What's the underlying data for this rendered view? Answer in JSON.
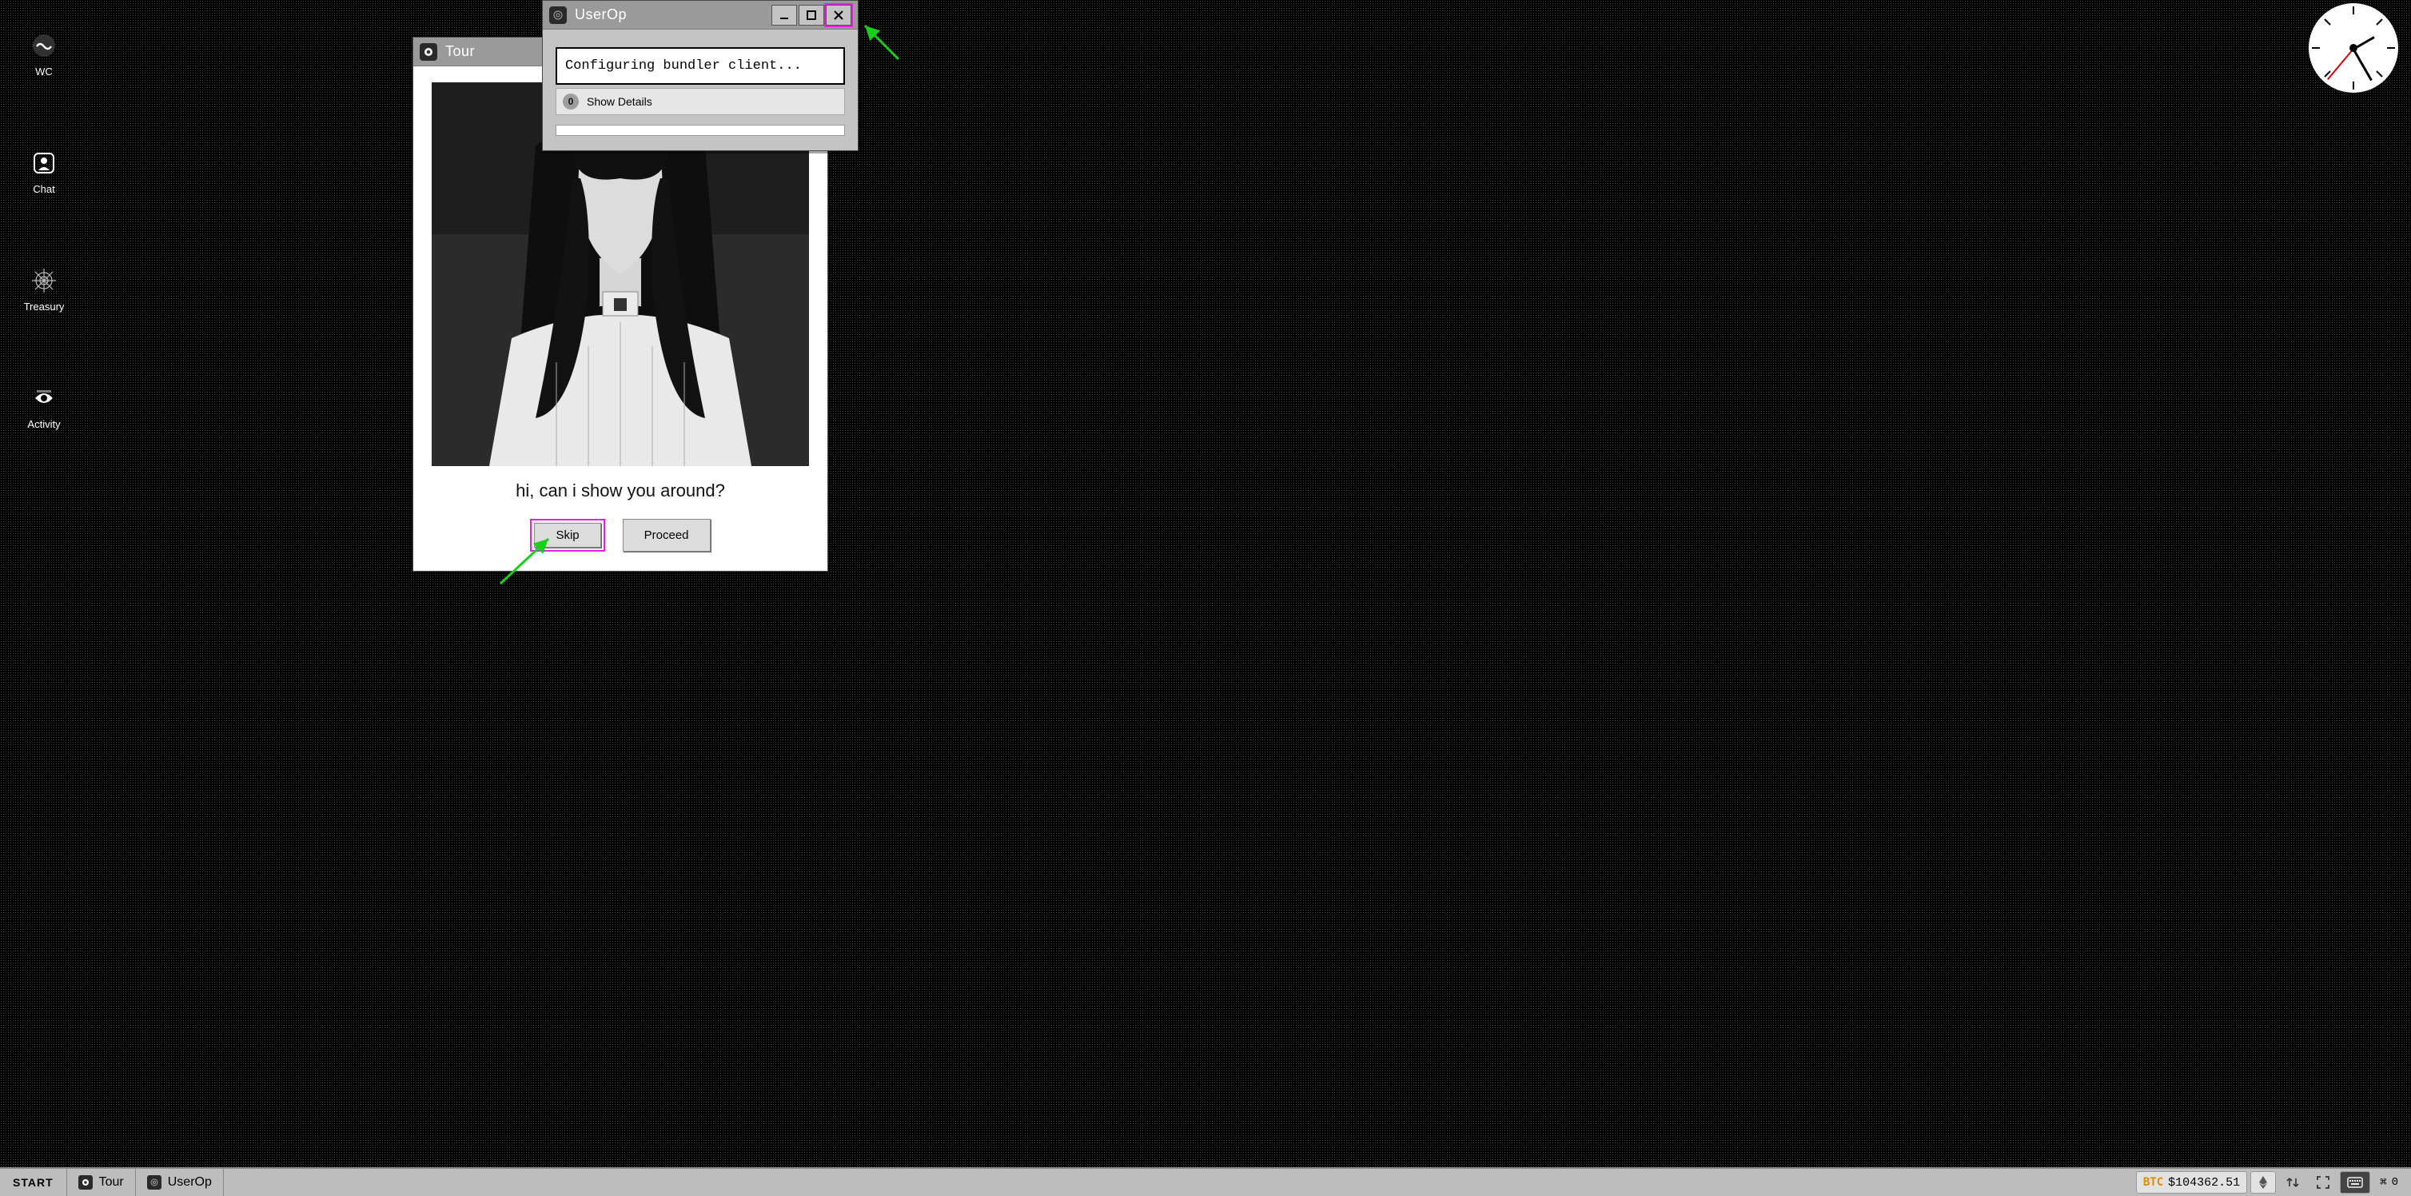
{
  "desktop": {
    "icons": [
      {
        "name": "wc-icon",
        "label": "WC"
      },
      {
        "name": "chat-icon",
        "label": "Chat"
      },
      {
        "name": "treasury-icon",
        "label": "Treasury"
      },
      {
        "name": "activity-icon",
        "label": "Activity"
      }
    ]
  },
  "tour_window": {
    "title": "Tour",
    "prompt": "hi, can i show you around?",
    "skip_label": "Skip",
    "proceed_label": "Proceed"
  },
  "userop_window": {
    "title": "UserOp",
    "status": "Configuring bundler client...",
    "details_badge": "0",
    "details_label": "Show Details"
  },
  "taskbar": {
    "start": "START",
    "tasks": [
      {
        "icon": "tour-app-icon",
        "label": "Tour"
      },
      {
        "icon": "userop-app-icon",
        "label": "UserOp"
      }
    ],
    "ticker": {
      "symbol": "BTC",
      "price": "$104362.51"
    },
    "shortcut": {
      "mod": "⌘",
      "key": "0"
    }
  },
  "colors": {
    "highlight": "#e61ee6",
    "arrow": "#17d017"
  }
}
